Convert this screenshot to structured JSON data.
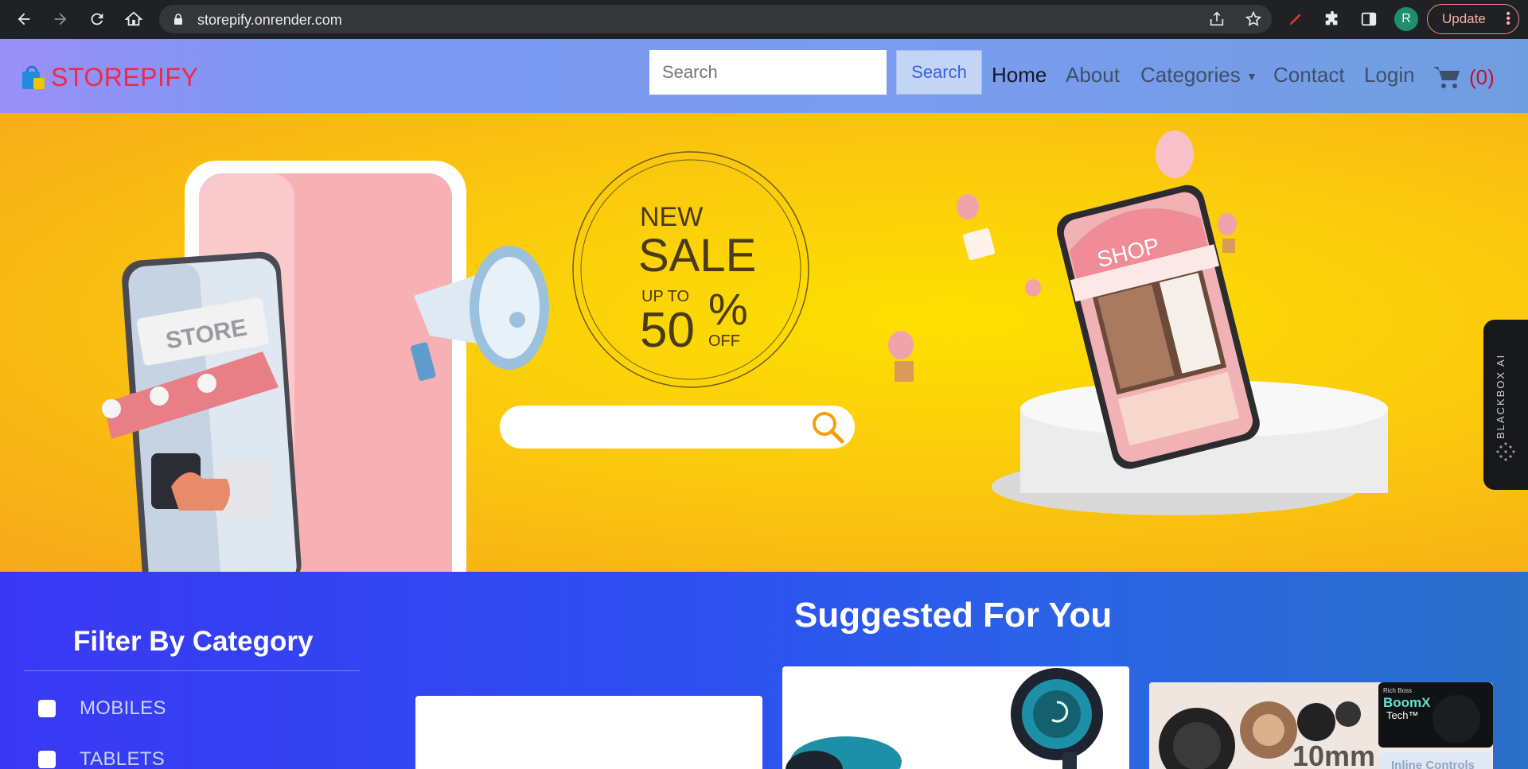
{
  "browser": {
    "url": "storepify.onrender.com",
    "avatar_letter": "R",
    "update_label": "Update",
    "icons": [
      "back-icon",
      "forward-icon",
      "reload-icon",
      "home-icon",
      "lock-icon",
      "share-icon",
      "star-icon",
      "pen-icon",
      "extensions-icon",
      "side-panel-icon",
      "kebab-menu-icon"
    ]
  },
  "site": {
    "brand": "STOREPIFY",
    "search_placeholder": "Search",
    "search_button": "Search",
    "nav": {
      "home": "Home",
      "about": "About",
      "categories": "Categories",
      "contact": "Contact",
      "login": "Login",
      "cart_count": "(0)"
    },
    "colors": {
      "brand": "#f0284a",
      "cart_count": "#c8102e",
      "hero_bg": "#fbcc0c",
      "lower_bg": "#2d4ff0"
    }
  },
  "hero": {
    "badge_new": "NEW",
    "badge_sale": "SALE",
    "badge_upto": "UP TO",
    "badge_value": "50",
    "badge_percent": "%",
    "badge_off": "OFF",
    "store_sign": "STORE",
    "shop_sign": "SHOP"
  },
  "filter": {
    "title": "Filter By Category",
    "items": [
      {
        "label": "MOBILES",
        "checked": false
      },
      {
        "label": "TABLETS",
        "checked": false
      }
    ]
  },
  "suggested": {
    "title": "Suggested For You",
    "card3_text_a": "10mm",
    "card3_brand_small": "Rich Boss",
    "card3_brand": "BoomX",
    "card3_brand_sub": "Tech™",
    "card3_caption": "Inline Controls"
  },
  "blackbox": {
    "label": "BLACKBOX AI"
  }
}
